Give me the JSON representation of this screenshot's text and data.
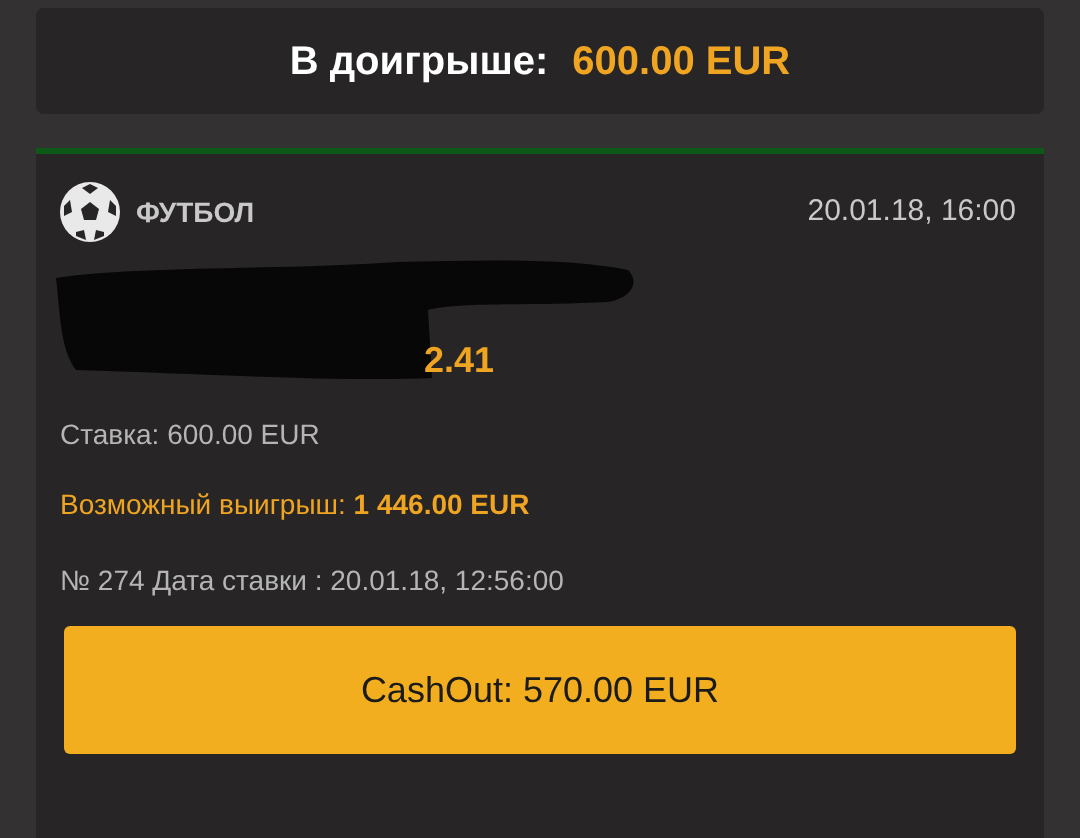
{
  "summary": {
    "label": "В доигрыше:",
    "amount": "600.00 EUR"
  },
  "bet": {
    "sport": "ФУТБОЛ",
    "event_time": "20.01.18, 16:00",
    "odds": "2.41",
    "stake": "Ставка: 600.00 EUR",
    "possible_win_label": "Возможный выигрыш:",
    "possible_win_amount": "1 446.00 EUR",
    "bet_info": "№ 274 Дата ставки : 20.01.18, 12:56:00",
    "cashout_button": "CashOut: 570.00 EUR"
  }
}
